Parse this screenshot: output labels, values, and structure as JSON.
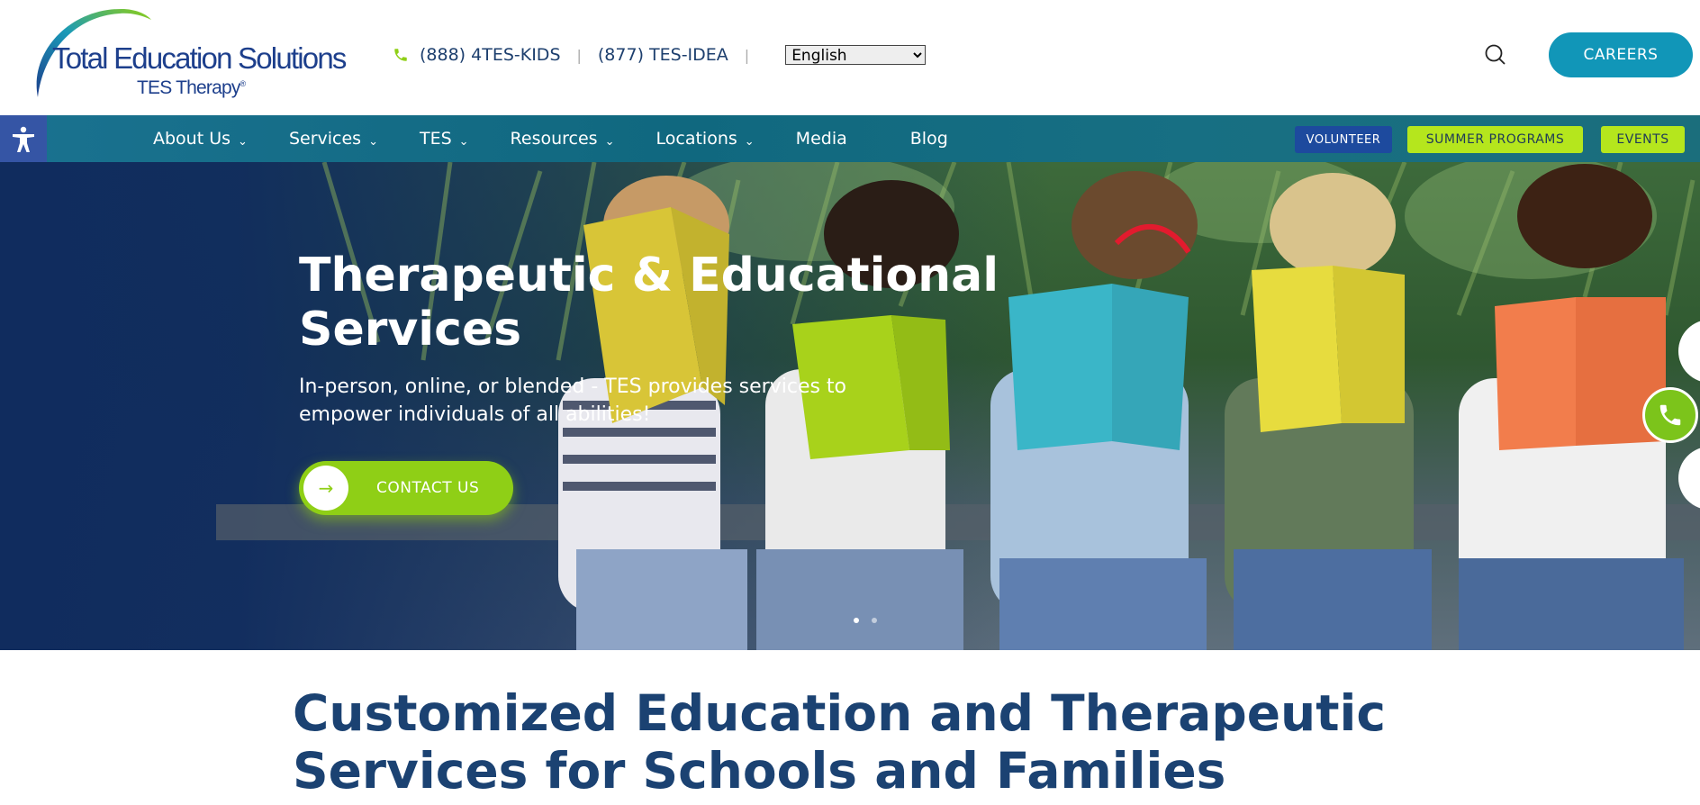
{
  "header": {
    "logo": {
      "title": "Total Education Solutions",
      "subtitle": "TES Therapy",
      "registered": "®"
    },
    "phones": [
      "(888) 4TES-KIDS",
      "(877) TES-IDEA"
    ],
    "separator": "|",
    "language": {
      "selected": "English"
    },
    "careers_label": "CAREERS",
    "icons": {
      "phone": "phone-icon",
      "search": "search-icon"
    }
  },
  "nav": {
    "items": [
      {
        "label": "About Us",
        "dropdown": true
      },
      {
        "label": "Services",
        "dropdown": true
      },
      {
        "label": "TES",
        "dropdown": true
      },
      {
        "label": "Resources",
        "dropdown": true
      },
      {
        "label": "Locations",
        "dropdown": true
      },
      {
        "label": "Media",
        "dropdown": false
      },
      {
        "label": "Blog",
        "dropdown": false
      }
    ],
    "chevron": "⌄",
    "volunteer_label": "VOLUNTEER",
    "summer_label": "SUMMER PROGRAMS",
    "events_label": "EVENTS"
  },
  "hero": {
    "title": "Therapeutic & Educational Services",
    "subtitle": "In-person, online, or blended - TES provides services to empower individuals of all abilities!",
    "cta_label": "CONTACT US",
    "cta_icon": "→",
    "slides": 2,
    "active_slide": 1
  },
  "section": {
    "title": "Customized Education and Therapeutic Services for Schools and Families"
  },
  "colors": {
    "brand_navy": "#1b4272",
    "brand_teal": "#1196b8",
    "brand_green": "#8fcf16",
    "lime": "#b5e61d",
    "accessibility": "#3555a5"
  }
}
